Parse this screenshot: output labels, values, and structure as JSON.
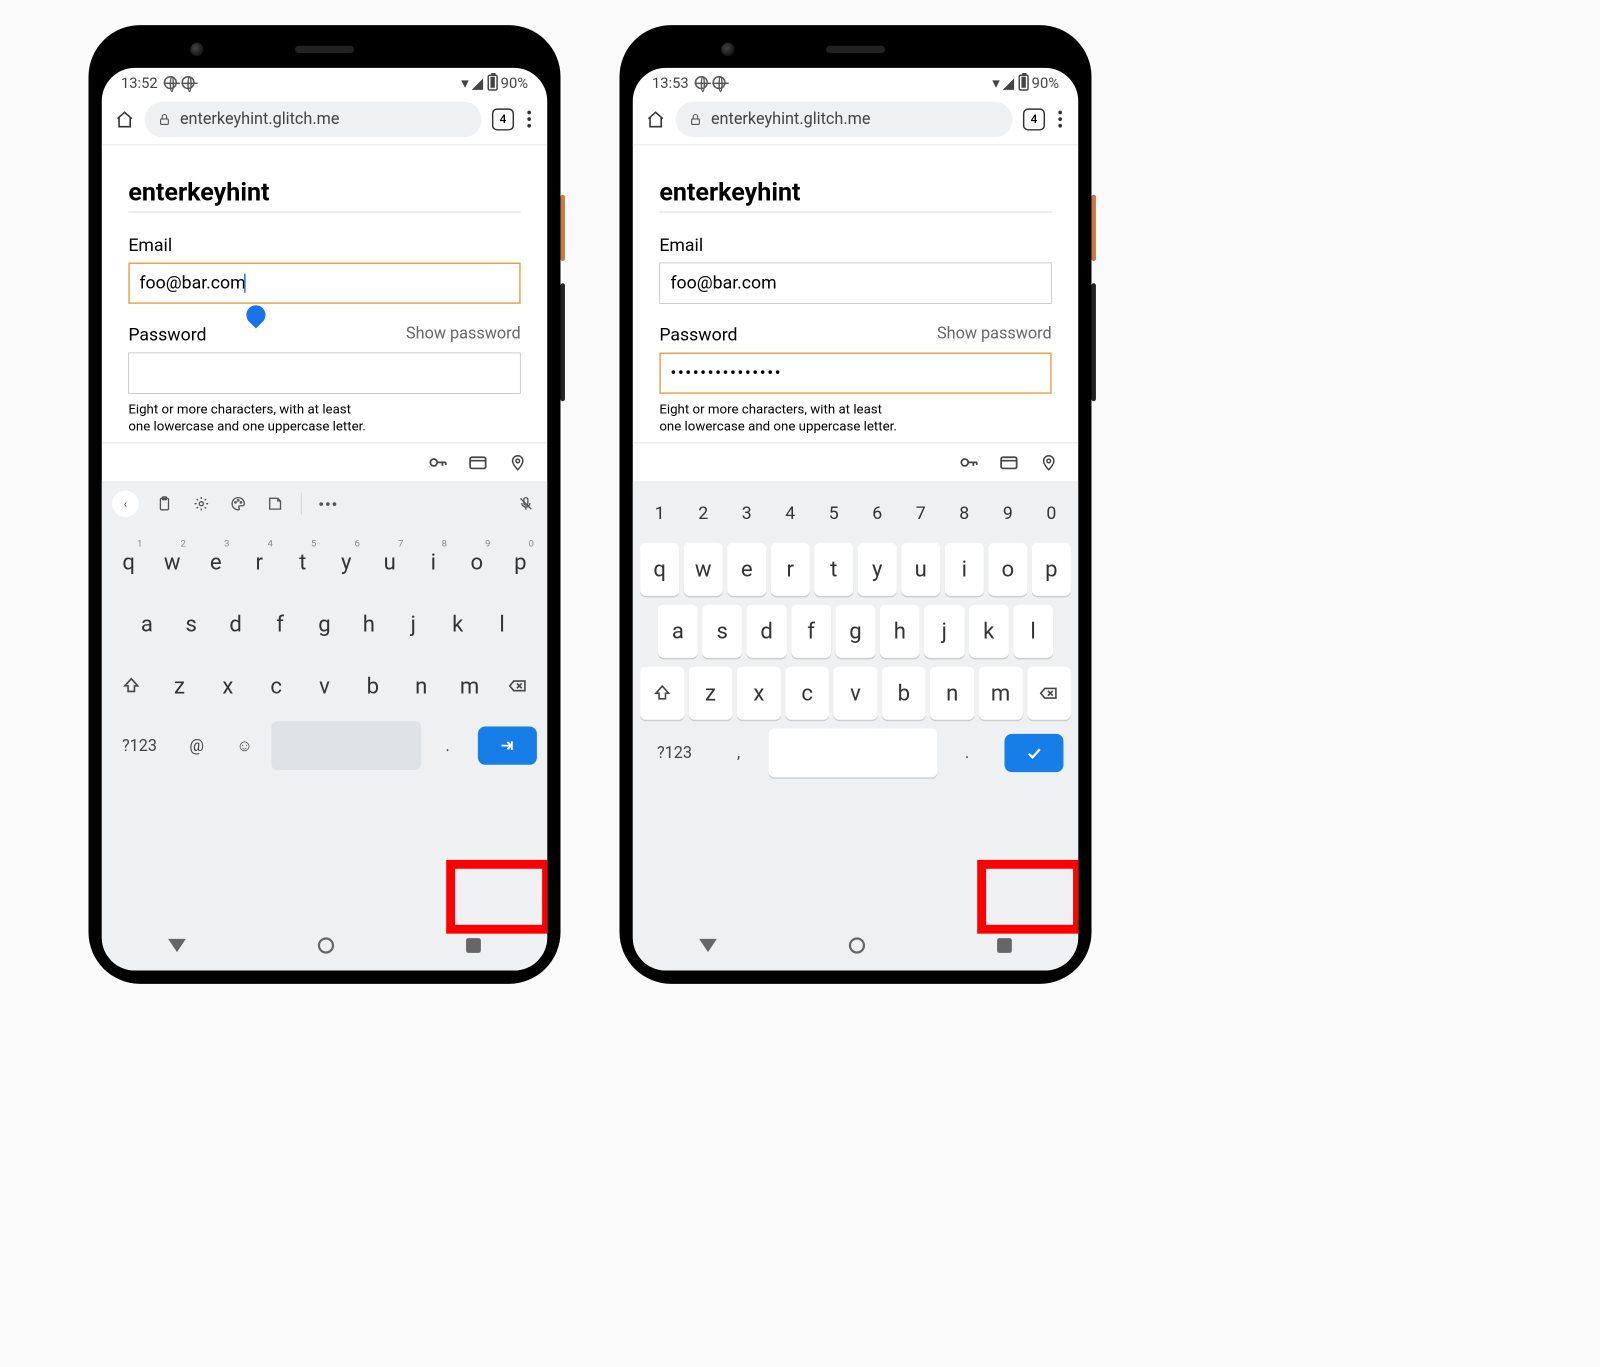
{
  "phones": [
    {
      "status": {
        "time": "13:52",
        "battery_text": "90%"
      },
      "omnibox": {
        "url": "enterkeyhint.glitch.me",
        "tab_count": "4"
      },
      "page": {
        "title": "enterkeyhint",
        "email_label": "Email",
        "email_value": "foo@bar.com",
        "email_focused": true,
        "password_label": "Password",
        "show_password": "Show password",
        "password_value": "",
        "password_focused": false,
        "hint_line1": "Eight or more characters, with at least",
        "hint_line2": "one lowercase and one uppercase letter."
      },
      "keyboard": {
        "show_suggestion_strip": true,
        "show_number_row": false,
        "row1": [
          "q",
          "w",
          "e",
          "r",
          "t",
          "y",
          "u",
          "i",
          "o",
          "p"
        ],
        "row1_sup": [
          "1",
          "2",
          "3",
          "4",
          "5",
          "6",
          "7",
          "8",
          "9",
          "0"
        ],
        "row2": [
          "a",
          "s",
          "d",
          "f",
          "g",
          "h",
          "j",
          "k",
          "l"
        ],
        "row3": [
          "z",
          "x",
          "c",
          "v",
          "b",
          "n",
          "m"
        ],
        "sym_label": "?123",
        "extra_key": "@",
        "period": ".",
        "enter_icon": "next",
        "white_keys": false
      }
    },
    {
      "status": {
        "time": "13:53",
        "battery_text": "90%"
      },
      "omnibox": {
        "url": "enterkeyhint.glitch.me",
        "tab_count": "4"
      },
      "page": {
        "title": "enterkeyhint",
        "email_label": "Email",
        "email_value": "foo@bar.com",
        "email_focused": false,
        "password_label": "Password",
        "show_password": "Show password",
        "password_value": "•••••••••••••••",
        "password_focused": true,
        "hint_line1": "Eight or more characters, with at least",
        "hint_line2": "one lowercase and one uppercase letter."
      },
      "keyboard": {
        "show_suggestion_strip": false,
        "show_number_row": true,
        "numrow": [
          "1",
          "2",
          "3",
          "4",
          "5",
          "6",
          "7",
          "8",
          "9",
          "0"
        ],
        "row1": [
          "q",
          "w",
          "e",
          "r",
          "t",
          "y",
          "u",
          "i",
          "o",
          "p"
        ],
        "row2": [
          "a",
          "s",
          "d",
          "f",
          "g",
          "h",
          "j",
          "k",
          "l"
        ],
        "row3": [
          "z",
          "x",
          "c",
          "v",
          "b",
          "n",
          "m"
        ],
        "sym_label": "?123",
        "extra_key": ",",
        "period": ".",
        "enter_icon": "done",
        "white_keys": true
      }
    }
  ]
}
